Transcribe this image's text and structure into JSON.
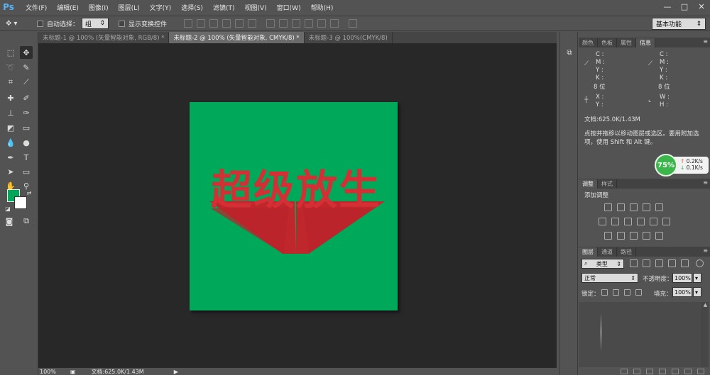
{
  "app": {
    "logo": "Ps"
  },
  "menu": [
    "文件(F)",
    "编辑(E)",
    "图像(I)",
    "图层(L)",
    "文字(Y)",
    "选择(S)",
    "滤镜(T)",
    "视图(V)",
    "窗口(W)",
    "帮助(H)"
  ],
  "window_controls": {
    "minimize": "—",
    "maximize": "□",
    "close": "✕"
  },
  "options": {
    "tool_icon": "move-tool-icon",
    "auto_select_label": "自动选择：",
    "auto_select_value": "组",
    "show_transform_label": "显示变换控件",
    "workspace": "基本功能"
  },
  "tabs": [
    {
      "label": "未标题-1 @ 100% (矢量智能对象, RGB/8) *",
      "active": false
    },
    {
      "label": "未标题-2 @ 100% (矢量智能对象, CMYK/8) *",
      "active": true
    },
    {
      "label": "未标题-3 @ 100%(CMYK/8)",
      "active": false
    }
  ],
  "canvas": {
    "background": "#282828",
    "artboard_color": "#00a859",
    "artwork_text": "超级放生",
    "artwork_color": "#d32f35"
  },
  "status": {
    "zoom": "100%",
    "doc": "文档:625.0K/1.43M"
  },
  "colors": {
    "foreground": "#00a859",
    "background": "#ffffff"
  },
  "info_panel": {
    "tabs": [
      "颜色",
      "色板",
      "属性",
      "信息"
    ],
    "left_cmyk": [
      "C :",
      "M :",
      "Y :",
      "K :"
    ],
    "right_cmyk": [
      "C :",
      "M :",
      "Y :",
      "K :"
    ],
    "bits_left": "8 位",
    "bits_right": "8 位",
    "xy": [
      "X :",
      "Y :"
    ],
    "wh": [
      "W :",
      "H :"
    ],
    "doc_size": "文档:625.0K/1.43M",
    "hint": "点按并拖移以移动图层或选区。要用附加选项，使用 Shift 和 Alt 键。"
  },
  "performance": {
    "percent": "75%",
    "up": "0.2K/s",
    "down": "0.1K/s"
  },
  "adjust_panel": {
    "tabs": [
      "调整",
      "样式"
    ],
    "title": "添加调整"
  },
  "layers_panel": {
    "tabs": [
      "图层",
      "通道",
      "路径"
    ],
    "filter_kind": "类型",
    "blend_mode": "正常",
    "opacity_label": "不透明度：",
    "opacity_value": "100%",
    "lock_label": "锁定：",
    "fill_label": "填充：",
    "fill_value": "100%"
  }
}
